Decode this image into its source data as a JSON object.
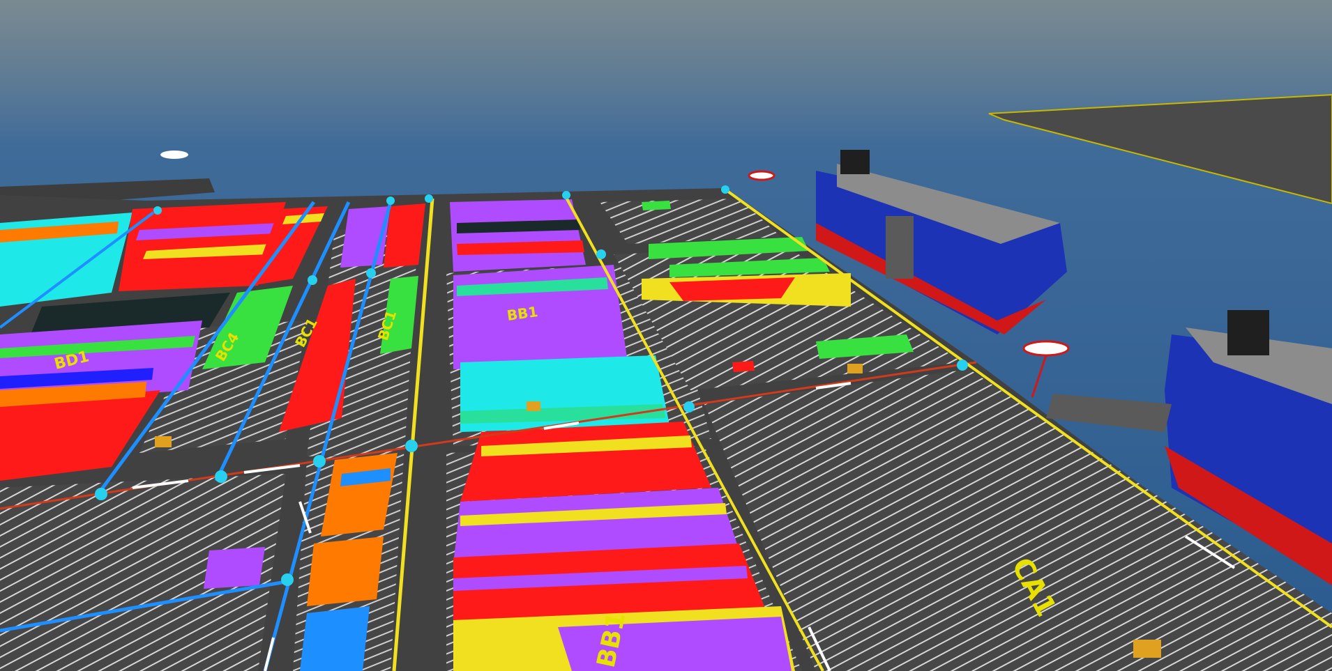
{
  "scene": {
    "type": "3d-port-terminal-container-yard",
    "colors": {
      "sky_top": "#7c8a92",
      "sea": "#2e5f93",
      "pavement": "#444444",
      "lane_blue": "#1e8fff",
      "lane_yellow": "#f0e020",
      "lane_red": "#d23a1c",
      "node_cyan": "#28d0f0",
      "ship_hull_blue": "#1d33b5",
      "ship_hull_red": "#d01818",
      "ship_deck": "#8c8c8c"
    },
    "block_labels": [
      "BD1",
      "BC4",
      "BC1",
      "BC1",
      "BB1",
      "CA1",
      "BB1"
    ],
    "container_colors": [
      "#ff1a1a",
      "#b04cff",
      "#1ee8e8",
      "#f0e020",
      "#28e09c",
      "#ff7a00",
      "#38e040",
      "#2020ff",
      "#1a2a2a",
      "#ff3ad8"
    ],
    "icons": [
      "ship-icon",
      "ship-icon",
      "berth-sign-icon",
      "berth-sign-icon",
      "berth-sign-icon",
      "light-tower-icon",
      "direction-arrow-icon"
    ]
  }
}
